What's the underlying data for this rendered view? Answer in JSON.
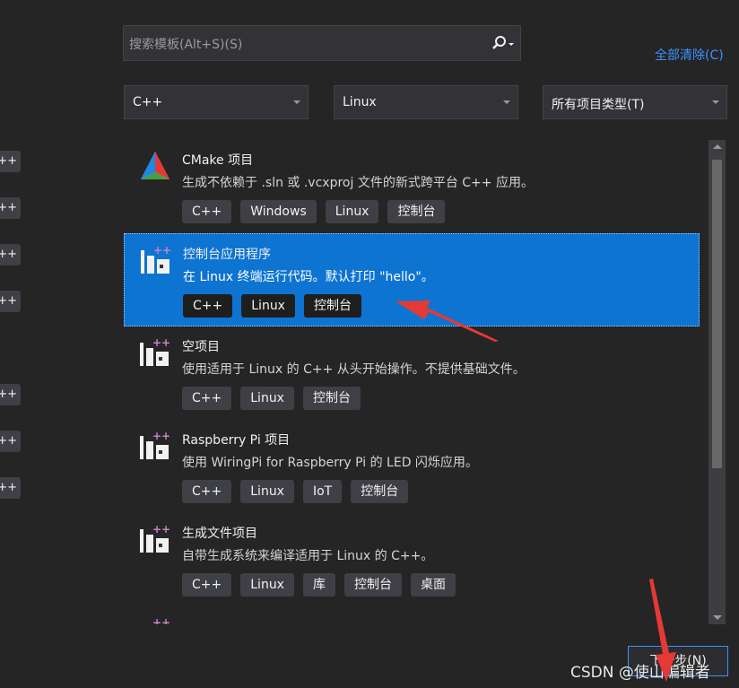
{
  "search": {
    "placeholder": "搜索模板(Alt+S)(S)"
  },
  "clear_all": "全部清除(C)",
  "filters": {
    "language": "C++",
    "platform": "Linux",
    "project_type": "所有项目类型(T)"
  },
  "left_tags": [
    "++",
    "++",
    "++",
    "++",
    "++",
    "++",
    "++"
  ],
  "templates": [
    {
      "title": "CMake 项目",
      "desc": "生成不依赖于 .sln 或 .vcxproj 文件的新式跨平台 C++ 应用。",
      "tags": [
        "C++",
        "Windows",
        "Linux",
        "控制台"
      ]
    },
    {
      "title": "控制台应用程序",
      "desc": "在 Linux 终端运行代码。默认打印 \"hello\"。",
      "tags": [
        "C++",
        "Linux",
        "控制台"
      ],
      "selected": true
    },
    {
      "title": "空项目",
      "desc": "使用适用于 Linux 的 C++ 从头开始操作。不提供基础文件。",
      "tags": [
        "C++",
        "Linux",
        "控制台"
      ]
    },
    {
      "title": "Raspberry Pi 项目",
      "desc": "使用 WiringPi for Raspberry Pi 的 LED 闪烁应用。",
      "tags": [
        "C++",
        "Linux",
        "IoT",
        "控制台"
      ]
    },
    {
      "title": "生成文件项目",
      "desc": "自带生成系统来编译适用于 Linux 的 C++。",
      "tags": [
        "C++",
        "Linux",
        "库",
        "控制台",
        "桌面"
      ]
    }
  ],
  "next_button": "下一步(N)",
  "watermark": "CSDN @使山编辑者",
  "colors": {
    "accent": "#0e74d2",
    "link": "#3794ff",
    "annotation_arrow": "#e53935"
  }
}
